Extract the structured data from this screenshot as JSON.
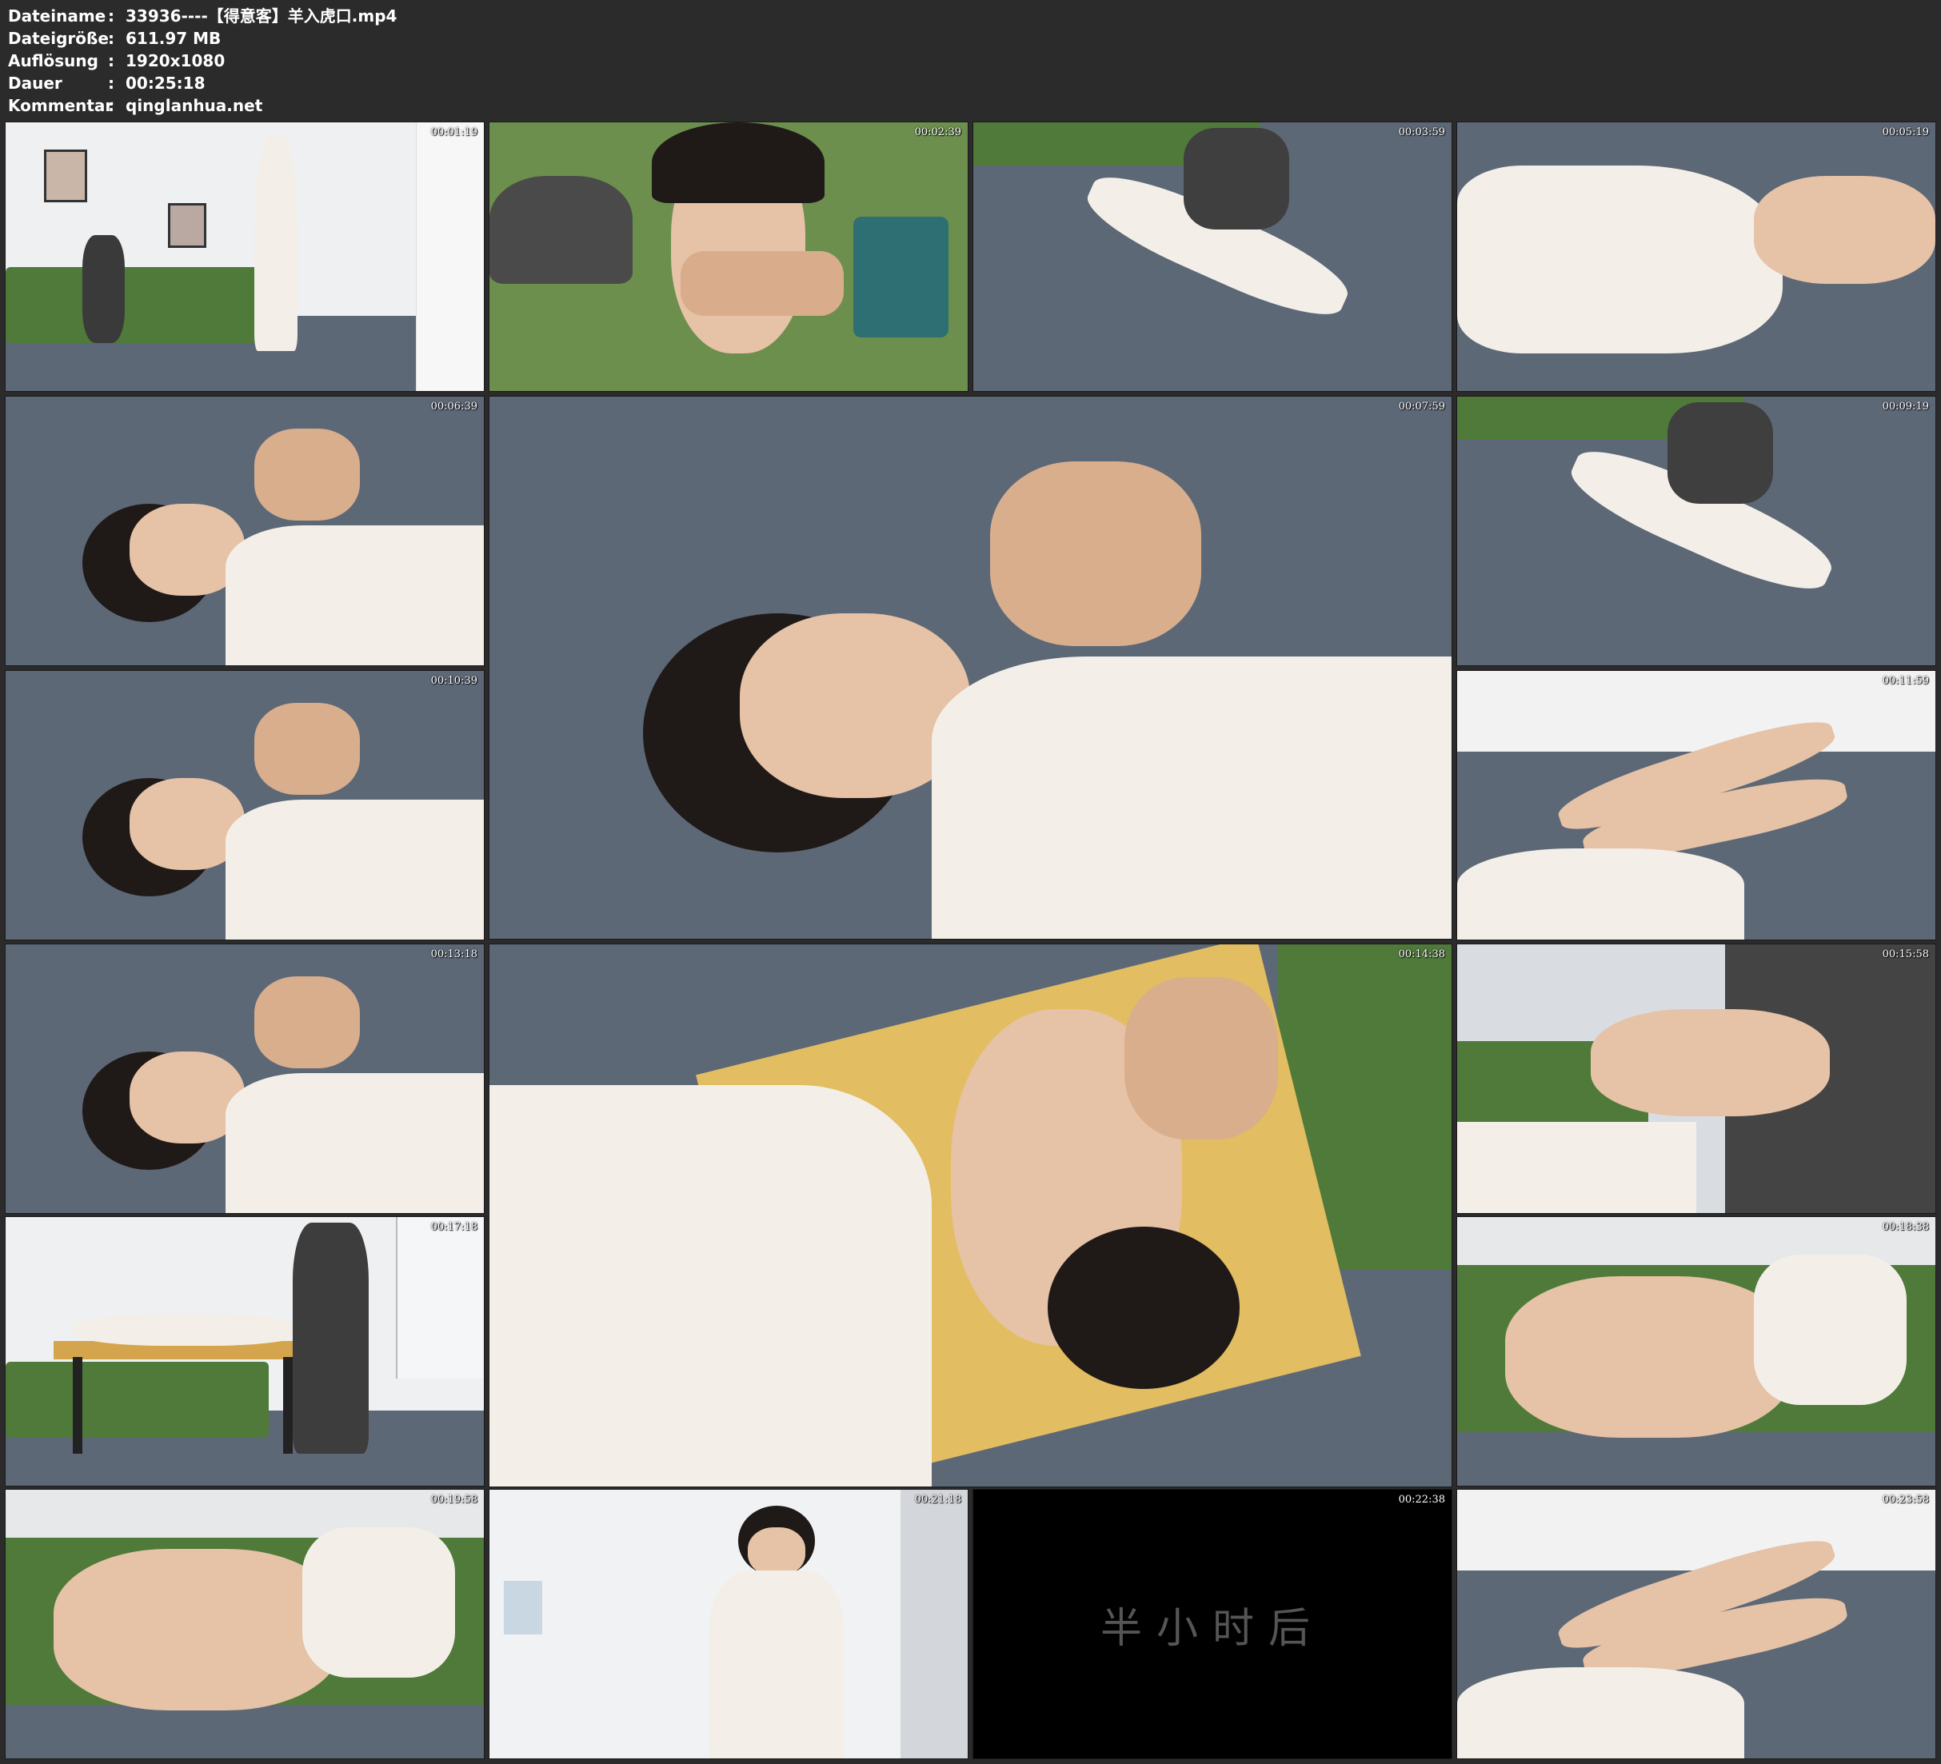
{
  "header": {
    "rows": [
      {
        "key": "Dateiname",
        "sep": ":",
        "value": "33936----【得意客】羊入虎口.mp4"
      },
      {
        "key": "Dateigröße",
        "sep": ":",
        "value": "611.97 MB"
      },
      {
        "key": "Auflösung",
        "sep": ":",
        "value": "1920x1080"
      },
      {
        "key": "Dauer",
        "sep": ":",
        "value": "00:25:18"
      },
      {
        "key": "Kommentar",
        "sep": ":",
        "value": "qinglanhua.net"
      }
    ]
  },
  "thumbnails": [
    {
      "time": "00:01:19",
      "scene": "room"
    },
    {
      "time": "00:02:39",
      "scene": "closeup-sofa"
    },
    {
      "time": "00:03:59",
      "scene": "carpet-wide"
    },
    {
      "time": "00:05:19",
      "scene": "dress-closeup"
    },
    {
      "time": "00:06:39",
      "scene": "carpet-face"
    },
    {
      "time": "00:07:59",
      "scene": "carpet-face"
    },
    {
      "time": "00:09:19",
      "scene": "carpet-wide"
    },
    {
      "time": "00:10:39",
      "scene": "carpet-face"
    },
    {
      "time": "00:11:59",
      "scene": "legs-floor"
    },
    {
      "time": "00:13:18",
      "scene": "carpet-face"
    },
    {
      "time": "00:14:38",
      "scene": "table-face"
    },
    {
      "time": "00:15:58",
      "scene": "hands-sofa"
    },
    {
      "time": "00:17:18",
      "scene": "room-table"
    },
    {
      "time": "00:18:38",
      "scene": "sofa-legs"
    },
    {
      "time": "00:19:58",
      "scene": "sofa-legs"
    },
    {
      "time": "00:21:18",
      "scene": "wall-sitting"
    },
    {
      "time": "00:22:38",
      "scene": "black",
      "overlay": "半小时后"
    },
    {
      "time": "00:23:58",
      "scene": "legs-floor"
    }
  ],
  "colors": {
    "background": "#2b2b2b",
    "carpet": "#5d6877",
    "sofa": "#4f7a3a",
    "wall": "#eef0f2",
    "dress": "#f3efe8",
    "skin": "#e6c2a6",
    "hair": "#1f1a18"
  }
}
